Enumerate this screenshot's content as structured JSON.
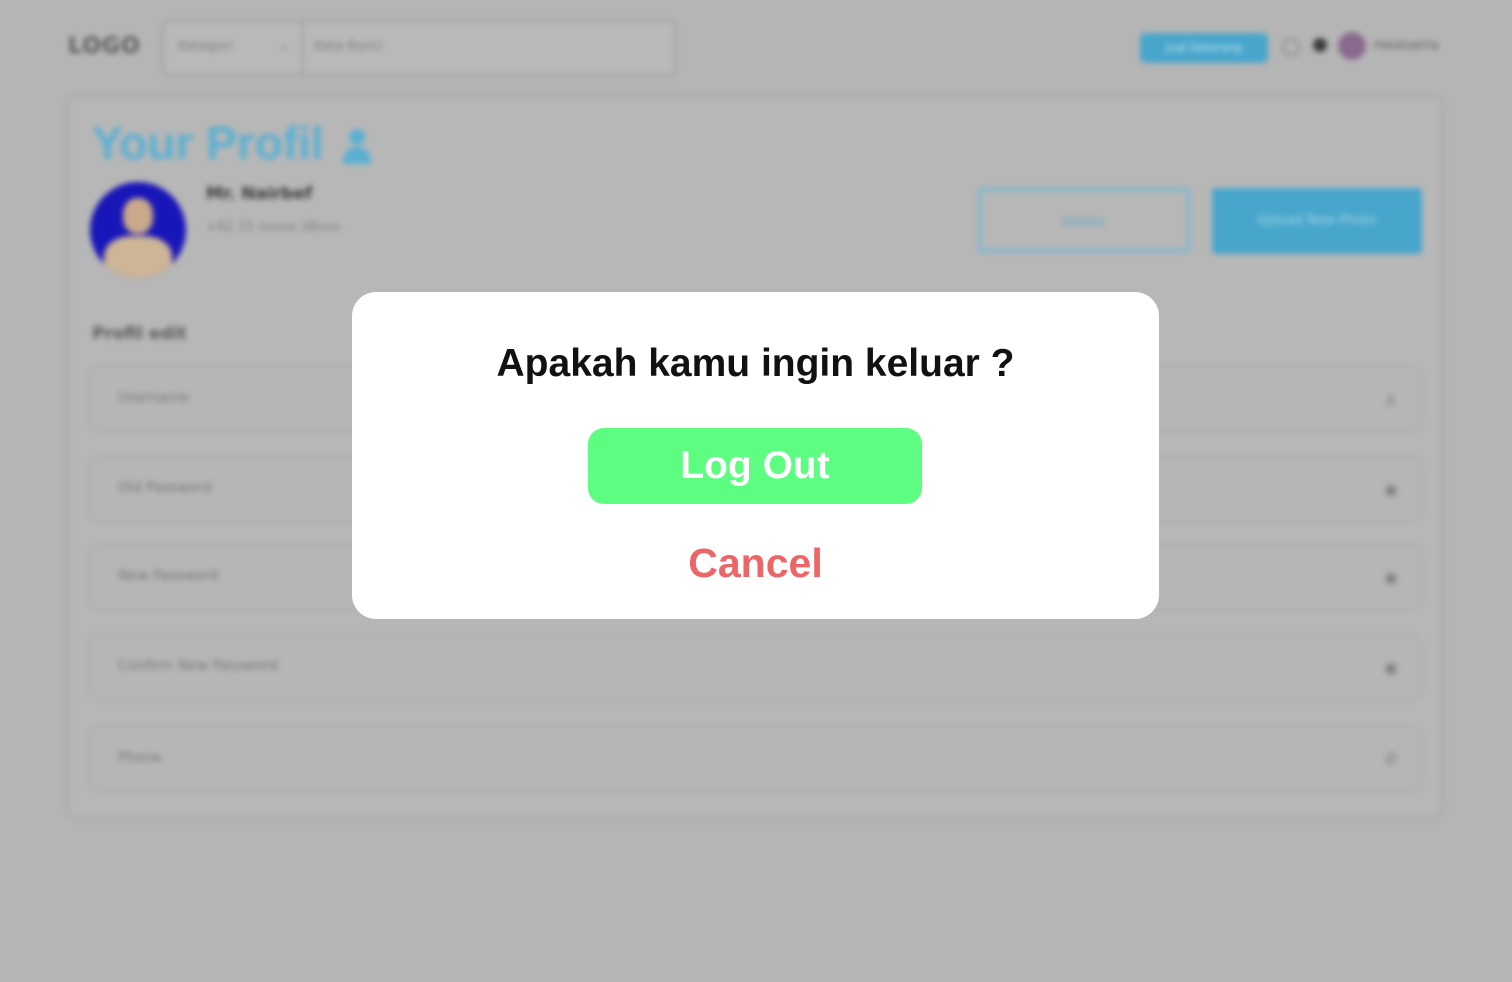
{
  "background": {
    "logo": "LOGO",
    "search": {
      "category_label": "Kategori",
      "placeholder": "Kata Kunci"
    },
    "header_badge": "Jual Sekarang",
    "username": "Halalsatria",
    "profile": {
      "title": "Your Profil",
      "name": "Mr. Nairbef",
      "subtitle": "+62 15 xxxxx 28xxx",
      "delete_label": "Delete",
      "upload_label": "Upload New Photo",
      "section_label": "Profil edit",
      "fields": [
        {
          "label": "Username",
          "icon": "person-icon"
        },
        {
          "label": "Old Password",
          "icon": "eye-icon"
        },
        {
          "label": "New Password",
          "icon": "eye-icon"
        },
        {
          "label": "Confirm New Password",
          "icon": "eye-icon"
        },
        {
          "label": "Phone",
          "icon": "phone-icon"
        }
      ]
    },
    "colors": {
      "overlay": "#b5b5b5",
      "accent": "#48a6cc"
    }
  },
  "modal": {
    "title": "Apakah kamu ingin keluar ?",
    "logout_label": "Log Out",
    "cancel_label": "Cancel",
    "colors": {
      "logout_bg": "#5cfd80",
      "cancel_text": "#ec6567"
    }
  }
}
